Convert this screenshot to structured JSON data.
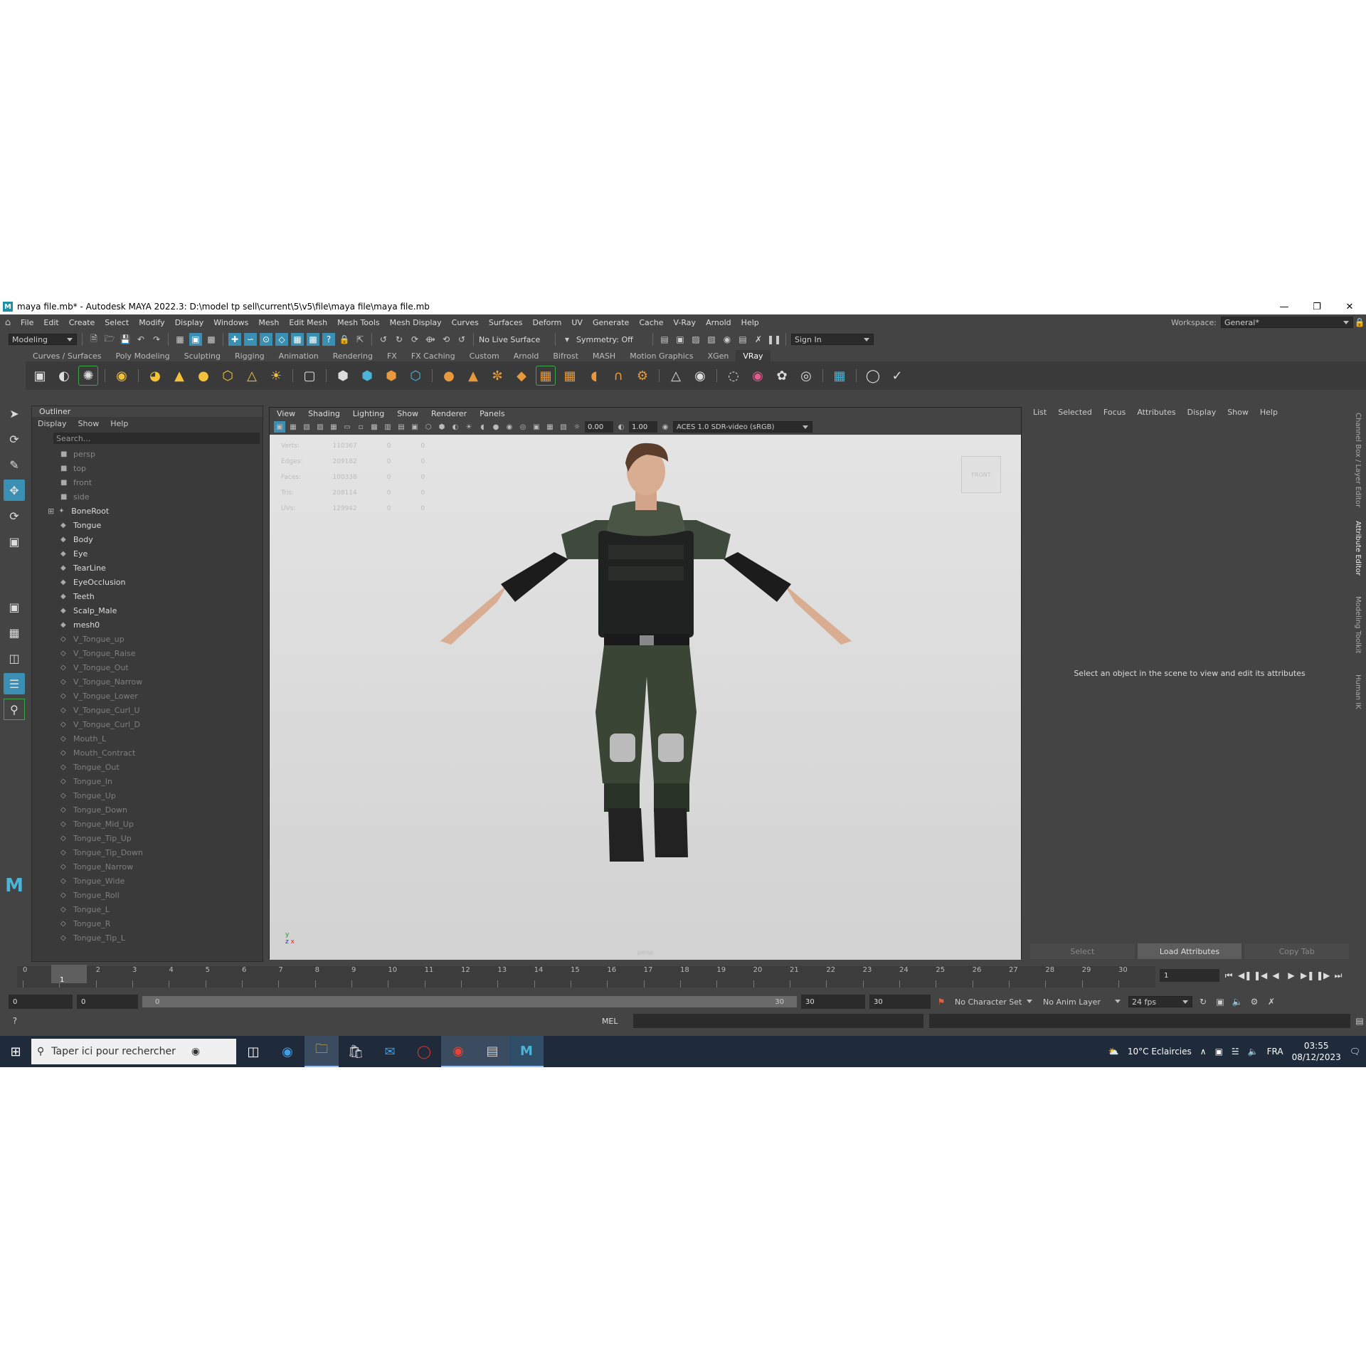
{
  "title_bar": {
    "text": "maya file.mb* - Autodesk MAYA 2022.3: D:\\model tp sell\\current\\5\\v5\\file\\maya file\\maya file.mb"
  },
  "menubar": [
    "File",
    "Edit",
    "Create",
    "Select",
    "Modify",
    "Display",
    "Windows",
    "Mesh",
    "Edit Mesh",
    "Mesh Tools",
    "Mesh Display",
    "Curves",
    "Surfaces",
    "Deform",
    "UV",
    "Generate",
    "Cache",
    "V-Ray",
    "Arnold",
    "Help"
  ],
  "workspace": {
    "label": "Workspace:",
    "value": "General*"
  },
  "status_line": {
    "mode": "Modeling",
    "live_surface": "No Live Surface",
    "symmetry": "Symmetry: Off",
    "sign_in": "Sign In"
  },
  "shelf_tabs": [
    "Curves / Surfaces",
    "Poly Modeling",
    "Sculpting",
    "Rigging",
    "Animation",
    "Rendering",
    "FX",
    "FX Caching",
    "Custom",
    "Arnold",
    "Bifrost",
    "MASH",
    "Motion Graphics",
    "XGen",
    "VRay"
  ],
  "shelf_active": "VRay",
  "outliner": {
    "title": "Outliner",
    "menu": [
      "Display",
      "Show",
      "Help"
    ],
    "search_placeholder": "Search...",
    "items": [
      {
        "name": "persp",
        "type": "camera"
      },
      {
        "name": "top",
        "type": "camera"
      },
      {
        "name": "front",
        "type": "camera"
      },
      {
        "name": "side",
        "type": "camera"
      },
      {
        "name": "BoneRoot",
        "type": "joint"
      },
      {
        "name": "Tongue",
        "type": "mesh"
      },
      {
        "name": "Body",
        "type": "mesh"
      },
      {
        "name": "Eye",
        "type": "mesh"
      },
      {
        "name": "TearLine",
        "type": "mesh"
      },
      {
        "name": "EyeOcclusion",
        "type": "mesh"
      },
      {
        "name": "Teeth",
        "type": "mesh"
      },
      {
        "name": "Scalp_Male",
        "type": "mesh"
      },
      {
        "name": "mesh0",
        "type": "mesh"
      },
      {
        "name": "V_Tongue_up",
        "type": "hidden"
      },
      {
        "name": "V_Tongue_Raise",
        "type": "hidden"
      },
      {
        "name": "V_Tongue_Out",
        "type": "hidden"
      },
      {
        "name": "V_Tongue_Narrow",
        "type": "hidden"
      },
      {
        "name": "V_Tongue_Lower",
        "type": "hidden"
      },
      {
        "name": "V_Tongue_Curl_U",
        "type": "hidden"
      },
      {
        "name": "V_Tongue_Curl_D",
        "type": "hidden"
      },
      {
        "name": "Mouth_L",
        "type": "hidden"
      },
      {
        "name": "Mouth_Contract",
        "type": "hidden"
      },
      {
        "name": "Tongue_Out",
        "type": "hidden"
      },
      {
        "name": "Tongue_In",
        "type": "hidden"
      },
      {
        "name": "Tongue_Up",
        "type": "hidden"
      },
      {
        "name": "Tongue_Down",
        "type": "hidden"
      },
      {
        "name": "Tongue_Mid_Up",
        "type": "hidden"
      },
      {
        "name": "Tongue_Tip_Up",
        "type": "hidden"
      },
      {
        "name": "Tongue_Tip_Down",
        "type": "hidden"
      },
      {
        "name": "Tongue_Narrow",
        "type": "hidden"
      },
      {
        "name": "Tongue_Wide",
        "type": "hidden"
      },
      {
        "name": "Tongue_Roll",
        "type": "hidden"
      },
      {
        "name": "Tongue_L",
        "type": "hidden"
      },
      {
        "name": "Tongue_R",
        "type": "hidden"
      },
      {
        "name": "Tongue_Tip_L",
        "type": "hidden"
      }
    ]
  },
  "viewport": {
    "menu": [
      "View",
      "Shading",
      "Lighting",
      "Show",
      "Renderer",
      "Panels"
    ],
    "exposure": "0.00",
    "gamma": "1.00",
    "color_space": "ACES 1.0 SDR-video (sRGB)",
    "hud": [
      {
        "label": "Verts:",
        "v1": "110367",
        "v2": "0",
        "v3": "0"
      },
      {
        "label": "Edges:",
        "v1": "209182",
        "v2": "0",
        "v3": "0"
      },
      {
        "label": "Faces:",
        "v1": "100338",
        "v2": "0",
        "v3": "0"
      },
      {
        "label": "Tris:",
        "v1": "208114",
        "v2": "0",
        "v3": "0"
      },
      {
        "label": "UVs:",
        "v1": "129942",
        "v2": "0",
        "v3": "0"
      }
    ],
    "viewcube": "FRONT",
    "camera": "persp"
  },
  "attribute_editor": {
    "menu": [
      "List",
      "Selected",
      "Focus",
      "Attributes",
      "Display",
      "Show",
      "Help"
    ],
    "message": "Select an object in the scene to view and edit its attributes",
    "buttons": [
      "Select",
      "Load Attributes",
      "Copy Tab"
    ]
  },
  "side_tabs": [
    "Channel Box / Layer Editor",
    "Attribute Editor",
    "Modeling Toolkit",
    "Human IK"
  ],
  "time_slider": {
    "ticks": [
      "0",
      "1",
      "2",
      "3",
      "4",
      "5",
      "6",
      "7",
      "8",
      "9",
      "10",
      "11",
      "12",
      "13",
      "14",
      "15",
      "16",
      "17",
      "18",
      "19",
      "20",
      "21",
      "22",
      "23",
      "24",
      "25",
      "26",
      "27",
      "28",
      "29",
      "30"
    ],
    "current_frame": "1",
    "current_field": "1"
  },
  "range_slider": {
    "start": "0",
    "inner_start": "0",
    "bar_start": "0",
    "bar_end": "30",
    "end": "30",
    "end_outer": "30",
    "character_set": "No Character Set",
    "anim_layer": "No Anim Layer",
    "fps": "24 fps"
  },
  "command_line": {
    "language": "MEL"
  },
  "taskbar": {
    "search_placeholder": "Taper ici pour rechercher",
    "weather": "10°C Eclaircies",
    "language": "FRA",
    "time": "03:55",
    "date": "08/12/2023"
  }
}
